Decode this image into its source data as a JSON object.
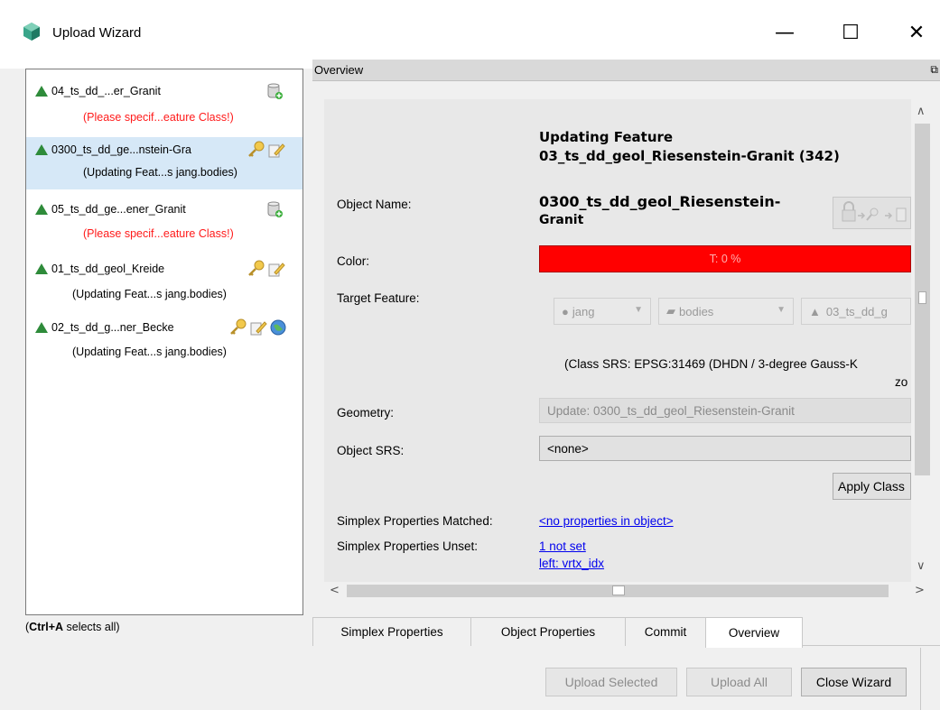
{
  "window": {
    "title": "Upload Wizard",
    "minimize_glyph": "—",
    "maximize_glyph": "☐",
    "close_glyph": "✕"
  },
  "tree": {
    "items": [
      {
        "label": "04_ts_dd_...er_Granit",
        "status": "(Please specif...eature Class!)",
        "status_kind": "error",
        "icons": [
          "database-add-icon"
        ]
      },
      {
        "label": "0300_ts_dd_ge...nstein-Gra",
        "status": "(Updating Feat...s jang.bodies)",
        "status_kind": "normal",
        "icons": [
          "key-icon",
          "edit-icon"
        ]
      },
      {
        "label": "05_ts_dd_ge...ener_Granit",
        "status": "(Please specif...eature Class!)",
        "status_kind": "error",
        "icons": [
          "database-add-icon"
        ]
      },
      {
        "label": "01_ts_dd_geol_Kreide",
        "status": "(Updating Feat...s jang.bodies)",
        "status_kind": "normal",
        "icons": [
          "key-icon",
          "edit-icon"
        ]
      },
      {
        "label": "02_ts_dd_g...ner_Becke",
        "status": "(Updating Feat...s jang.bodies)",
        "status_kind": "normal",
        "icons": [
          "key-icon",
          "edit-icon",
          "globe-icon"
        ]
      }
    ],
    "hint_bold": "Ctrl+A",
    "hint_rest": " selects all)",
    "hint_open": "("
  },
  "overview": {
    "header": "Overview",
    "heading_line1": "Updating Feature",
    "heading_line2": "03_ts_dd_geol_Riesenstein-Granit (342)",
    "object_name_label": "Object Name:",
    "object_name_line1": "0300_ts_dd_geol_Riesenstein-",
    "object_name_line2": "Granit",
    "color_label": "Color:",
    "color_value": "T: 0 %",
    "color_hex": "#ff0000",
    "target_feature_label": "Target Feature:",
    "target_user": "jang",
    "target_folder": "bodies",
    "target_feature": "03_ts_dd_g",
    "class_srs_line1": "(Class SRS: EPSG:31469 (DHDN / 3-degree Gauss-K",
    "class_srs_line2": "zo",
    "geometry_label": "Geometry:",
    "geometry_value": "Update: 0300_ts_dd_geol_Riesenstein-Granit",
    "object_srs_label": "Object SRS:",
    "object_srs_value": "<none>",
    "apply_button": "Apply Class",
    "simplex_matched_label": "Simplex Properties Matched:",
    "simplex_matched_value": "<no properties in object>",
    "simplex_unset_label": "Simplex Properties Unset:",
    "simplex_unset_value1": "1 not set",
    "simplex_unset_value2": "left: vrtx_idx"
  },
  "tabs": [
    "Simplex Properties",
    "Object Properties",
    "Commit",
    "Overview"
  ],
  "active_tab": "Overview",
  "buttons": {
    "upload_selected": "Upload Selected",
    "upload_all": "Upload All",
    "close_wizard": "Close Wizard"
  }
}
